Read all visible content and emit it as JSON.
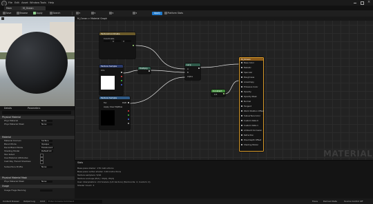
{
  "menu": {
    "items": [
      "File",
      "Edit",
      "Asset",
      "Window",
      "Tools",
      "Help"
    ]
  },
  "tabs": [
    {
      "label": "Main"
    },
    {
      "label": "M_Ocean"
    }
  ],
  "toolbar": {
    "save_label": "Save",
    "browse_label": "Browse",
    "apply_label": "Apply",
    "platform_label": "Platform Stats",
    "search_label": "Search"
  },
  "graph_tab": {
    "label": "M_Ocean > Material Graph"
  },
  "details": {
    "tabs": [
      "Details",
      "Parameters"
    ],
    "sections": [
      {
        "label": "Physical Material",
        "props": [
          {
            "name": "Phys Material",
            "value": "None"
          },
          {
            "name": "Phys Material Mask",
            "value": "None"
          }
        ]
      },
      {
        "label": "Material",
        "props": [
          {
            "name": "Material Domain",
            "value": "Surface"
          },
          {
            "name": "Blend Mode",
            "value": "Opaque"
          },
          {
            "name": "Decal Blend Mode",
            "value": "Translucent"
          },
          {
            "name": "Shading Model",
            "value": "Default Lit"
          },
          {
            "name": "Two Sided",
            "value": ""
          },
          {
            "name": "Use Material Attributes",
            "value": ""
          },
          {
            "name": "Cast Ray Traced Shadows",
            "value": ""
          },
          {
            "name": "Subsurface Profile",
            "value": "None"
          }
        ]
      },
      {
        "label": "Physical Material Mask",
        "props": [
          {
            "name": "Phys Material Mask",
            "value": "None"
          }
        ]
      },
      {
        "label": "Usage",
        "props": [
          {
            "name": "Usage Flags Warning",
            "value": ""
          }
        ]
      }
    ]
  },
  "nodes": {
    "texcoord": {
      "title": "TextureCoordinate",
      "pins": [
        "Coordinate",
        "U",
        "V"
      ]
    },
    "texture_a": {
      "title": "Texture Sample",
      "pins": [
        "UVs",
        "RGB",
        "R",
        "G",
        "B",
        "A"
      ]
    },
    "multiply": {
      "title": "Multiply",
      "pins": [
        "A",
        "B"
      ]
    },
    "lerp": {
      "title": "Lerp",
      "pins": [
        "A",
        "B",
        "Alpha"
      ]
    },
    "texture_b": {
      "title": "Texture Sample",
      "pins": [
        "UVs",
        "Tex",
        "Apply View MipBias",
        "RGB",
        "R",
        "G",
        "B",
        "A",
        "RGBA"
      ]
    },
    "constant": {
      "title": "Constant",
      "value": "0.5"
    },
    "output": {
      "title": "M_Ocean",
      "pins": [
        "Base Color",
        "Metallic",
        "Specular",
        "Roughness",
        "Anisotropy",
        "Emissive Color",
        "Opacity",
        "Opacity Mask",
        "Normal",
        "Tangent",
        "World Position Offset",
        "Subsurface Color",
        "Custom Data 0",
        "Custom Data 1",
        "Ambient Occlusion",
        "Refraction",
        "Pixel Depth Offset",
        "Shading Model"
      ]
    }
  },
  "watermark": "MATERIAL",
  "log": {
    "lines": [
      "Base pass shader: 176 instructions",
      "Base pass vertex shader: 100 instructions",
      "Texture samplers: 5/16",
      "Texture Lookups (Est.): VS(0), PS(3)",
      "User interpolators: 2/4 Scalars (1/4 Vectors) (TexCoords: 2, Custom: 0)",
      "Shader Count: 3"
    ]
  },
  "status": {
    "content_drawer": "Content Drawer",
    "output_log": "Output Log",
    "cmd": "Cmd",
    "console_placeholder": "Enter Console Command",
    "trace": "Trace",
    "derived_data": "Derived Data",
    "source_control": "Source Control Off"
  }
}
